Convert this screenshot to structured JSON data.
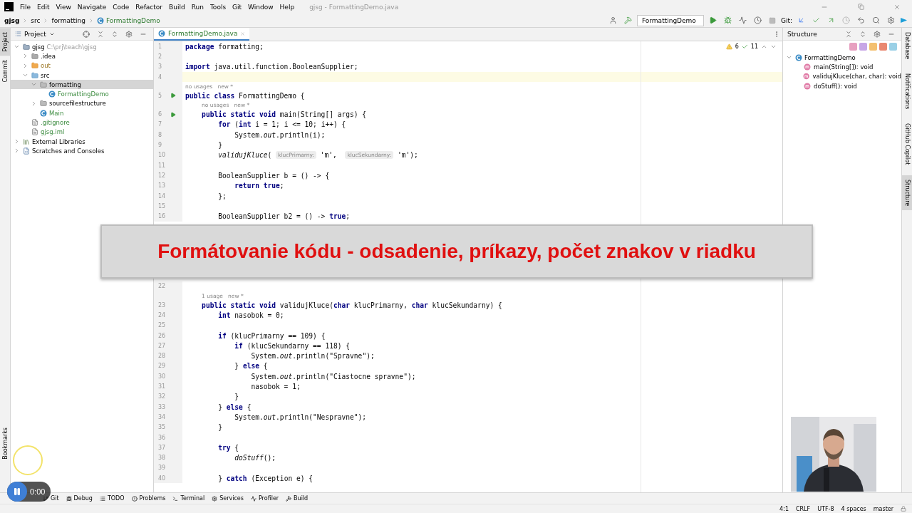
{
  "window": {
    "title": "gjsg - FormattingDemo.java"
  },
  "menu": [
    "File",
    "Edit",
    "View",
    "Navigate",
    "Code",
    "Refactor",
    "Build",
    "Run",
    "Tools",
    "Git",
    "Window",
    "Help"
  ],
  "breadcrumbs": [
    "gjsg",
    "src",
    "formatting",
    "FormattingDemo"
  ],
  "run_config": "FormattingDemo",
  "git_label": "Git:",
  "left_stripe": [
    {
      "label": "Project",
      "selected": true
    },
    {
      "label": "Commit",
      "selected": false
    }
  ],
  "left_stripe_bottom": [
    {
      "label": "Bookmarks",
      "selected": false
    }
  ],
  "project_panel": {
    "title": "Project",
    "tree": [
      {
        "label": "gjsg",
        "detail": "C:\\prj\\teach\\gjsg",
        "kind": "module",
        "added": false,
        "expanded": true,
        "selected": false,
        "children": [
          {
            "label": ".idea",
            "kind": "folder",
            "added": false,
            "expanded": false,
            "selected": false
          },
          {
            "label": "out",
            "kind": "excluded",
            "added": false,
            "expanded": false,
            "selected": false
          },
          {
            "label": "src",
            "kind": "source",
            "added": false,
            "expanded": true,
            "selected": false,
            "children": [
              {
                "label": "formatting",
                "kind": "package",
                "added": false,
                "expanded": true,
                "selected": true,
                "children": [
                  {
                    "label": "FormattingDemo",
                    "kind": "class",
                    "added": true,
                    "selected": false
                  }
                ]
              },
              {
                "label": "sourcefilestructure",
                "kind": "package",
                "added": false,
                "expanded": false,
                "selected": false
              },
              {
                "label": "Main",
                "kind": "class",
                "added": true,
                "selected": false
              }
            ]
          },
          {
            "label": ".gitignore",
            "kind": "file",
            "added": true,
            "selected": false
          },
          {
            "label": "gjsg.iml",
            "kind": "file",
            "added": true,
            "selected": false
          }
        ]
      },
      {
        "label": "External Libraries",
        "kind": "library",
        "added": false,
        "expanded": false,
        "selected": false
      },
      {
        "label": "Scratches and Consoles",
        "kind": "scratch",
        "added": false,
        "expanded": false,
        "selected": false
      }
    ]
  },
  "editor": {
    "tabs": [
      {
        "label": "FormattingDemo.java",
        "selected": true
      }
    ],
    "warnings": "6",
    "checks": "11",
    "lines": [
      {
        "number": "1",
        "code": "**package** formatting;"
      },
      {
        "number": "2"
      },
      {
        "number": "3",
        "code": "**import** java.util.function.BooleanSupplier;"
      },
      {
        "number": "4",
        "current": true
      },
      {
        "number": "5",
        "code": "**public class** FormattingDemo {",
        "run": true,
        "lens": {
          "usages": "no usages",
          "author": "new *"
        }
      },
      {
        "number": "6",
        "code": "    **public static void** main(String[] args) {",
        "run": true,
        "lens": {
          "usages": "no usages",
          "author": "new *"
        }
      },
      {
        "number": "7",
        "code": "        **for** (**int** i = 1; i <= 10; i++) {"
      },
      {
        "number": "8",
        "code": "            System.*out*.println(i);"
      },
      {
        "number": "9",
        "code": "        }"
      },
      {
        "number": "10",
        "parts": [
          {
            "kind": "code",
            "text": "        *validujKluce*( "
          },
          {
            "kind": "hint",
            "text": "klucPrimarny:"
          },
          {
            "kind": "code",
            "text": " 'm',  "
          },
          {
            "kind": "hint",
            "text": "klucSekundarny:"
          },
          {
            "kind": "code",
            "text": " 'm');"
          }
        ]
      },
      {
        "number": "11"
      },
      {
        "number": "12",
        "code": "        BooleanSupplier b = () -> {"
      },
      {
        "number": "13",
        "code": "            **return true**;"
      },
      {
        "number": "14",
        "code": "        };"
      },
      {
        "number": "15"
      },
      {
        "number": "16",
        "code": "        BooleanSupplier b2 = () -> **true**;"
      }
    ],
    "lines_after_banner": [
      {
        "number": "22"
      },
      {
        "number": "23",
        "code": "    **public static void** validujKluce(**char** klucPrimarny, **char** klucSekundarny) {",
        "lens": {
          "usages": "1 usage",
          "author": "new *"
        }
      },
      {
        "number": "24",
        "code": "        **int** nasobok = 0;"
      },
      {
        "number": "25"
      },
      {
        "number": "26",
        "code": "        **if** (klucPrimarny == 109) {"
      },
      {
        "number": "27",
        "code": "            **if** (klucSekundarny == 118) {"
      },
      {
        "number": "28",
        "code": "                System.*out*.println(\"Spravne\");"
      },
      {
        "number": "29",
        "code": "            } **else** {"
      },
      {
        "number": "30",
        "code": "                System.*out*.println(\"Ciastocne spravne\");"
      },
      {
        "number": "31",
        "code": "                nasobok = 1;"
      },
      {
        "number": "32",
        "code": "            }"
      },
      {
        "number": "33",
        "code": "        } **else** {"
      },
      {
        "number": "34",
        "code": "            System.*out*.println(\"Nespravne\");"
      },
      {
        "number": "35",
        "code": "        }"
      },
      {
        "number": "36"
      },
      {
        "number": "37",
        "code": "        **try** {"
      },
      {
        "number": "38",
        "code": "            *doStuff*();"
      },
      {
        "number": "39"
      },
      {
        "number": "40",
        "code": "        } **catch** (Exception e) {"
      }
    ]
  },
  "structure_panel": {
    "title": "Structure",
    "tree": [
      {
        "label": "FormattingDemo",
        "kind": "class",
        "expanded": true,
        "children": [
          {
            "label": "main(String[]): void",
            "kind": "method"
          },
          {
            "label": "validujKluce(char, char): void",
            "kind": "method"
          },
          {
            "label": "doStuff(): void",
            "kind": "method"
          }
        ]
      }
    ]
  },
  "right_stripe": [
    {
      "label": "Database",
      "selected": false
    },
    {
      "label": "Notifications",
      "selected": false
    },
    {
      "label": "GitHub Copilot",
      "selected": false
    },
    {
      "label": "Structure",
      "selected": true
    }
  ],
  "tool_tabs": [
    "Git",
    "Debug",
    "TODO",
    "Problems",
    "Terminal",
    "Services",
    "Profiler",
    "Build"
  ],
  "status_bar": [
    "4:1",
    "CRLF",
    "UTF-8",
    "4 spaces",
    "master"
  ],
  "banner": {
    "text": "Formátovanie kódu - odsadenie, príkazy, počet znakov v riadku"
  },
  "video": {
    "time": "0:00"
  },
  "webcam": {
    "kind": "picture"
  }
}
